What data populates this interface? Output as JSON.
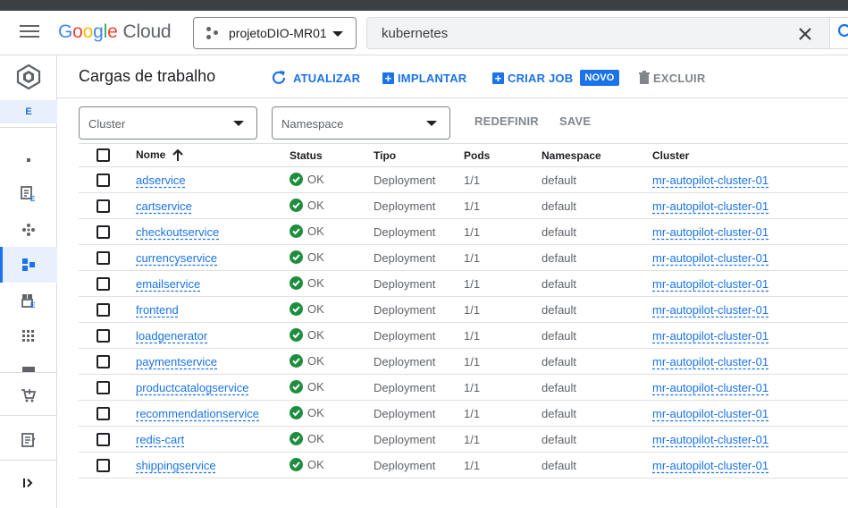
{
  "header": {
    "logo": {
      "g1": "G",
      "g2": "o",
      "g3": "o",
      "g4": "g",
      "g5": "l",
      "g6": "e",
      "cloud": "Cloud"
    },
    "project": "projetoDIO-MR01",
    "search_value": "kubernetes"
  },
  "nav": {
    "badge": "E"
  },
  "toolbar": {
    "title": "Cargas de trabalho",
    "refresh_label": "ATUALIZAR",
    "deploy_label": "IMPLANTAR",
    "create_job_label": "CRIAR JOB",
    "new_badge": "NOVO",
    "delete_label": "EXCLUIR"
  },
  "filters": {
    "cluster_placeholder": "Cluster",
    "namespace_placeholder": "Namespace",
    "reset_label": "REDEFINIR",
    "save_label": "SAVE"
  },
  "table": {
    "columns": {
      "name": "Nome",
      "status": "Status",
      "type": "Tipo",
      "pods": "Pods",
      "namespace": "Namespace",
      "cluster": "Cluster"
    },
    "rows": [
      {
        "name": "adservice",
        "status": "OK",
        "type": "Deployment",
        "pods": "1/1",
        "namespace": "default",
        "cluster": "mr-autopilot-cluster-01"
      },
      {
        "name": "cartservice",
        "status": "OK",
        "type": "Deployment",
        "pods": "1/1",
        "namespace": "default",
        "cluster": "mr-autopilot-cluster-01"
      },
      {
        "name": "checkoutservice",
        "status": "OK",
        "type": "Deployment",
        "pods": "1/1",
        "namespace": "default",
        "cluster": "mr-autopilot-cluster-01"
      },
      {
        "name": "currencyservice",
        "status": "OK",
        "type": "Deployment",
        "pods": "1/1",
        "namespace": "default",
        "cluster": "mr-autopilot-cluster-01"
      },
      {
        "name": "emailservice",
        "status": "OK",
        "type": "Deployment",
        "pods": "1/1",
        "namespace": "default",
        "cluster": "mr-autopilot-cluster-01"
      },
      {
        "name": "frontend",
        "status": "OK",
        "type": "Deployment",
        "pods": "1/1",
        "namespace": "default",
        "cluster": "mr-autopilot-cluster-01"
      },
      {
        "name": "loadgenerator",
        "status": "OK",
        "type": "Deployment",
        "pods": "1/1",
        "namespace": "default",
        "cluster": "mr-autopilot-cluster-01"
      },
      {
        "name": "paymentservice",
        "status": "OK",
        "type": "Deployment",
        "pods": "1/1",
        "namespace": "default",
        "cluster": "mr-autopilot-cluster-01"
      },
      {
        "name": "productcatalogservice",
        "status": "OK",
        "type": "Deployment",
        "pods": "1/1",
        "namespace": "default",
        "cluster": "mr-autopilot-cluster-01"
      },
      {
        "name": "recommendationservice",
        "status": "OK",
        "type": "Deployment",
        "pods": "1/1",
        "namespace": "default",
        "cluster": "mr-autopilot-cluster-01"
      },
      {
        "name": "redis-cart",
        "status": "OK",
        "type": "Deployment",
        "pods": "1/1",
        "namespace": "default",
        "cluster": "mr-autopilot-cluster-01"
      },
      {
        "name": "shippingservice",
        "status": "OK",
        "type": "Deployment",
        "pods": "1/1",
        "namespace": "default",
        "cluster": "mr-autopilot-cluster-01"
      }
    ]
  },
  "colors": {
    "accent": "#1a73e8",
    "ok": "#1e8e3e"
  }
}
